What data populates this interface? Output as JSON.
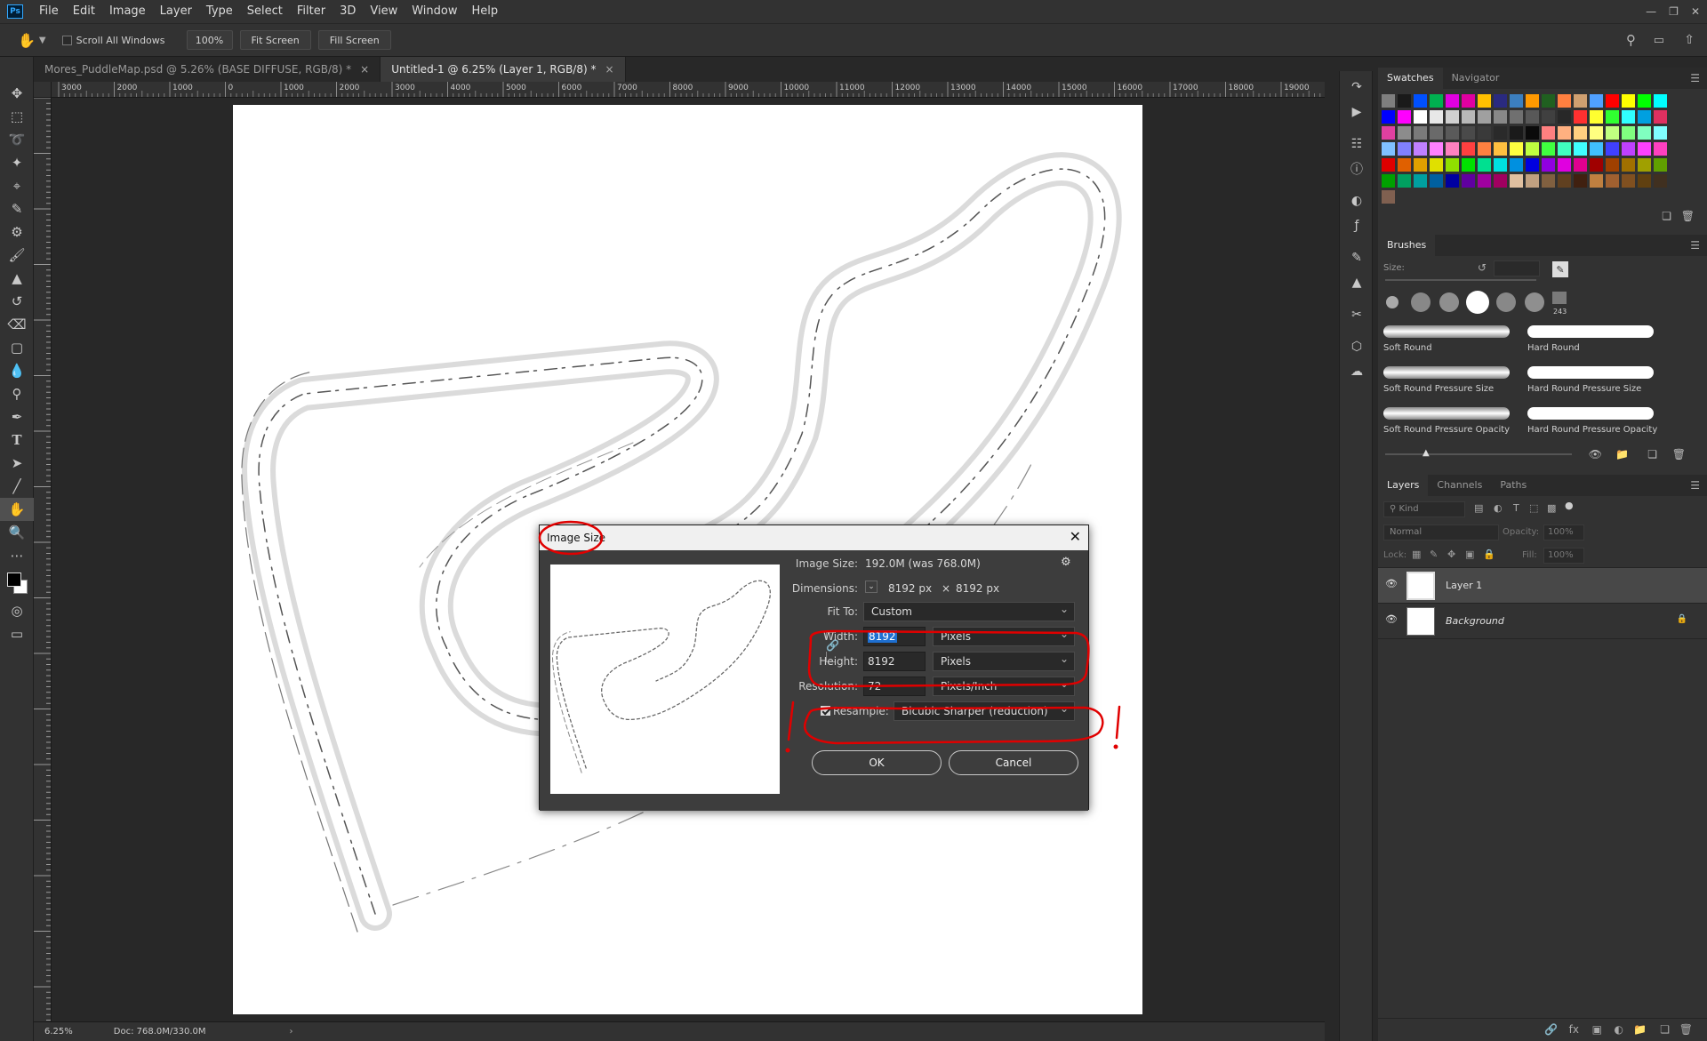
{
  "app": {
    "logo": "Ps"
  },
  "menubar": {
    "items": [
      "File",
      "Edit",
      "Image",
      "Layer",
      "Type",
      "Select",
      "Filter",
      "3D",
      "View",
      "Window",
      "Help"
    ]
  },
  "options_bar": {
    "scroll_all_windows": "Scroll All Windows",
    "zoom_100": "100%",
    "fit_screen": "Fit Screen",
    "fill_screen": "Fill Screen"
  },
  "doc_tabs": [
    {
      "label": "Mores_PuddleMap.psd @ 5.26% (BASE DIFFUSE, RGB/8) *",
      "active": false
    },
    {
      "label": "Untitled-1 @ 6.25% (Layer 1, RGB/8) *",
      "active": true
    }
  ],
  "ruler_top_labels": [
    "3000",
    "2000",
    "1000",
    "0",
    "1000",
    "2000",
    "3000",
    "4000",
    "5000",
    "6000",
    "7000",
    "8000",
    "9000",
    "10000",
    "11000",
    "12000",
    "13000",
    "14000",
    "15000",
    "16000",
    "17000",
    "18000",
    "19000"
  ],
  "status": {
    "zoom": "6.25%",
    "doc": "Doc: 768.0M/330.0M"
  },
  "panels": {
    "swatches_tab": "Swatches",
    "navigator_tab": "Navigator",
    "brushes_tab": "Brushes",
    "brush_size_label": "Size:",
    "brush_count": "243",
    "brush_presets": [
      "Soft Round",
      "Hard Round",
      "Soft Round Pressure Size",
      "Hard Round Pressure Size",
      "Soft Round Pressure Opacity",
      "Hard Round Pressure Opacity"
    ],
    "layers_tab": "Layers",
    "channels_tab": "Channels",
    "paths_tab": "Paths",
    "kind_filter": "Kind",
    "blend_mode": "Normal",
    "opacity_label": "Opacity:",
    "opacity_value": "100%",
    "lock_label": "Lock:",
    "fill_label": "Fill:",
    "fill_value": "100%",
    "layers": [
      {
        "name": "Layer 1",
        "selected": true
      },
      {
        "name": "Background",
        "selected": false
      }
    ]
  },
  "swatch_colors": [
    "#7f7f7f",
    "#1a1a1a",
    "#0050ff",
    "#00b050",
    "#e000e0",
    "#e000a0",
    "#ffc000",
    "#2a2a80",
    "#3c7fbf",
    "#ff9900",
    "#206020",
    "#ff8040",
    "#d0a070",
    "#50a0ff",
    "#ff0000",
    "#ffff00",
    "#00ff00",
    "#00ffff",
    "#0000ff",
    "#ff00ff",
    "#ffffff",
    "#e8e8e8",
    "#d0d0d0",
    "#b8b8b8",
    "#a0a0a0",
    "#888888",
    "#707070",
    "#585858",
    "#404040",
    "#282828",
    "#ff3030",
    "#ffff30",
    "#30ff30",
    "#30ffff",
    "#00a0e0",
    "#e03060",
    "#e040a0",
    "#8c8c8c",
    "#7a7a7a",
    "#6a6a6a",
    "#5a5a5a",
    "#4a4a4a",
    "#3a3a3a",
    "#2a2a2a",
    "#1a1a1a",
    "#0a0a0a",
    "#ff8080",
    "#ffb080",
    "#ffd080",
    "#ffff80",
    "#c0ff80",
    "#80ff80",
    "#80ffc0",
    "#80ffff",
    "#80c0ff",
    "#8080ff",
    "#c080ff",
    "#ff80ff",
    "#ff80c0",
    "#ff4040",
    "#ff8040",
    "#ffc040",
    "#ffff40",
    "#c0ff40",
    "#40ff40",
    "#40ffc0",
    "#40ffff",
    "#40c0ff",
    "#4040ff",
    "#c040ff",
    "#ff40ff",
    "#ff40c0",
    "#e00000",
    "#e06000",
    "#e0a000",
    "#e0e000",
    "#90e000",
    "#00e000",
    "#00e090",
    "#00e0e0",
    "#0090e0",
    "#0000e0",
    "#9000e0",
    "#e000e0",
    "#e00090",
    "#a00000",
    "#a04000",
    "#a07000",
    "#a0a000",
    "#60a000",
    "#00a000",
    "#00a060",
    "#00a0a0",
    "#0060a0",
    "#0000a0",
    "#6000a0",
    "#a000a0",
    "#a00060",
    "#e0c0a0",
    "#c0a080",
    "#806040",
    "#604020",
    "#402010",
    "#c08040",
    "#a06030",
    "#805020",
    "#604010",
    "#403020",
    "#806050"
  ],
  "dialog": {
    "title": "Image Size",
    "image_size_label": "Image Size:",
    "image_size_value": "192.0M (was 768.0M)",
    "dimensions_label": "Dimensions:",
    "dim_w": "8192 px",
    "dim_x": "×",
    "dim_h": "8192 px",
    "fit_to_label": "Fit To:",
    "fit_to_value": "Custom",
    "width_label": "Width:",
    "width_value": "8192",
    "width_unit": "Pixels",
    "height_label": "Height:",
    "height_value": "8192",
    "height_unit": "Pixels",
    "resolution_label": "Resolution:",
    "resolution_value": "72",
    "resolution_unit": "Pixels/Inch",
    "resample_label": "Resample:",
    "resample_value": "Bicubic Sharper (reduction)",
    "ok_label": "OK",
    "cancel_label": "Cancel"
  },
  "colors": {
    "accent_red": "#e00000",
    "dialog_bg": "#3d3d3d",
    "app_bg": "#282828",
    "panel_bg": "#323232"
  }
}
